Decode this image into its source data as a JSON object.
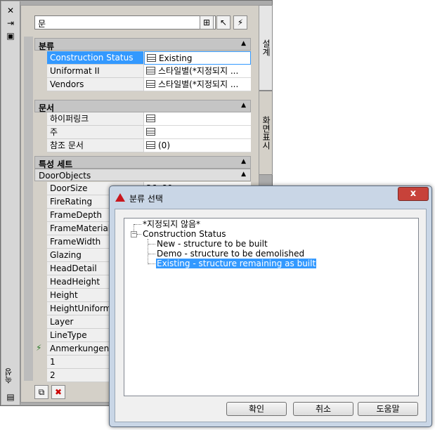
{
  "palette": {
    "side_label": "속성",
    "combo_value": "문",
    "tabs": {
      "design": "설계",
      "display": "화면표시"
    },
    "sections": {
      "classification": "분류",
      "documents": "문서",
      "property_sets": "특성 세트",
      "door_objects": "DoorObjects"
    },
    "classification_rows": [
      {
        "name": "Construction Status",
        "value": "Existing"
      },
      {
        "name": "Uniformat II",
        "value": "스타일별(*지정되지 ..."
      },
      {
        "name": "Vendors",
        "value": "스타일별(*지정되지 ..."
      }
    ],
    "document_rows": [
      {
        "name": "하이퍼링크",
        "value": ""
      },
      {
        "name": "주",
        "value": ""
      },
      {
        "name": "참조 문서",
        "value": "(0)"
      }
    ],
    "door_rows": [
      {
        "name": "DoorSize",
        "value": "36x80"
      },
      {
        "name": "FireRating",
        "value": ""
      },
      {
        "name": "FrameDepth",
        "value": ""
      },
      {
        "name": "FrameMaterial",
        "value": ""
      },
      {
        "name": "FrameWidth",
        "value": ""
      },
      {
        "name": "Glazing",
        "value": ""
      },
      {
        "name": "HeadDetail",
        "value": ""
      },
      {
        "name": "HeadHeight",
        "value": ""
      },
      {
        "name": "Height",
        "value": ""
      },
      {
        "name": "HeightUniformat",
        "value": ""
      },
      {
        "name": "Layer",
        "value": ""
      },
      {
        "name": "LineType",
        "value": ""
      },
      {
        "name": "Anmerkungen",
        "value": ""
      },
      {
        "name": "1",
        "value": ""
      },
      {
        "name": "2",
        "value": ""
      }
    ]
  },
  "dialog": {
    "title": "분류 선택",
    "close_glyph": "x",
    "tree": {
      "not_specified": "*지정되지 않음*",
      "root": "Construction Status",
      "children": [
        "New - structure to be built",
        "Demo - structure to be demolished",
        "Existing - structure remaining as built"
      ],
      "selected_index": 2
    },
    "buttons": {
      "ok": "확인",
      "cancel": "취소",
      "help": "도움말"
    }
  },
  "colors": {
    "selection": "#3399ff",
    "panel": "#d4d0c8",
    "dialog_frame": "#c9d6e6",
    "close": "#c7423a"
  }
}
